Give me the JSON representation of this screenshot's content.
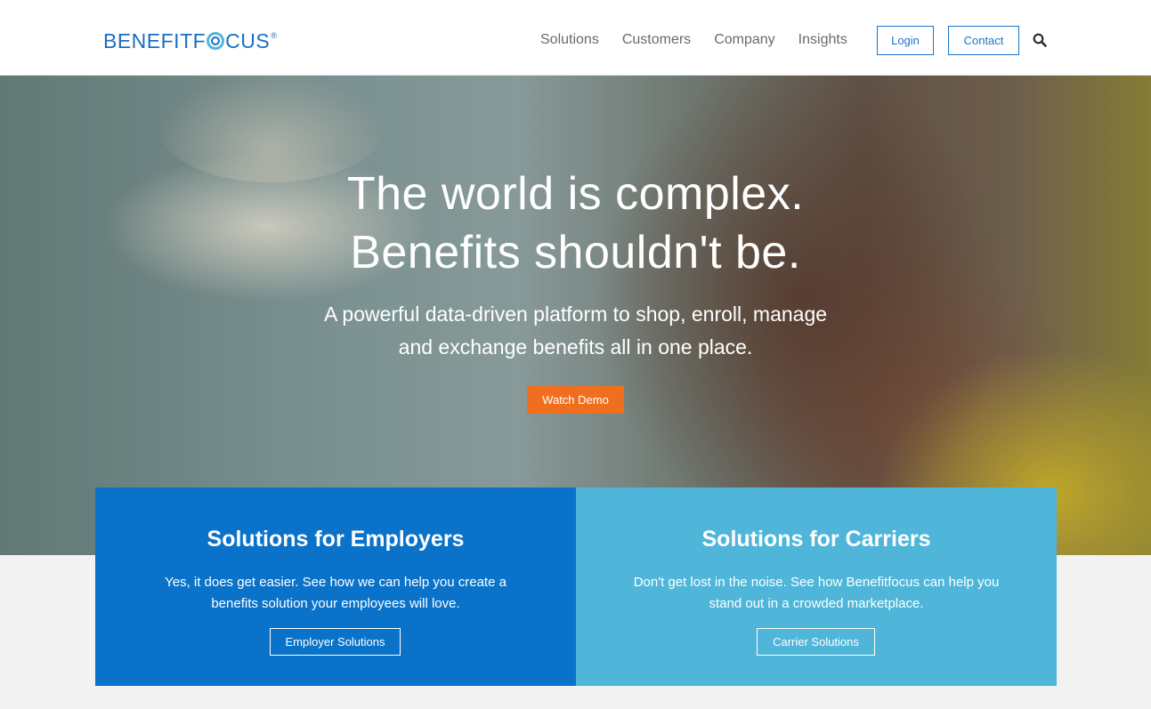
{
  "header": {
    "logo": {
      "pre": "BENEFITF",
      "post": "CUS",
      "reg": "®"
    },
    "nav": [
      "Solutions",
      "Customers",
      "Company",
      "Insights"
    ],
    "login_label": "Login",
    "contact_label": "Contact",
    "search_icon": "search-icon"
  },
  "hero": {
    "title_line1": "The world is complex.",
    "title_line2": "Benefits shouldn't be.",
    "subtitle_line1": "A powerful data-driven platform to shop, enroll, manage",
    "subtitle_line2": "and exchange benefits all in one place.",
    "cta_label": "Watch Demo"
  },
  "cards": {
    "employers": {
      "title": "Solutions for Employers",
      "text_line1": "Yes, it does get easier. See how we can help you create a",
      "text_line2": "benefits solution your employees will love.",
      "button": "Employer Solutions"
    },
    "carriers": {
      "title": "Solutions for Carriers",
      "text_line1": "Don't get lost in the noise. See how Benefitfocus can help you",
      "text_line2": "stand out in a crowded marketplace.",
      "button": "Carrier Solutions"
    }
  },
  "colors": {
    "brand_blue": "#1976c9",
    "cta_orange": "#f06f1f",
    "employers_bg": "#0a73c9",
    "carriers_bg": "#4fb6d9"
  }
}
